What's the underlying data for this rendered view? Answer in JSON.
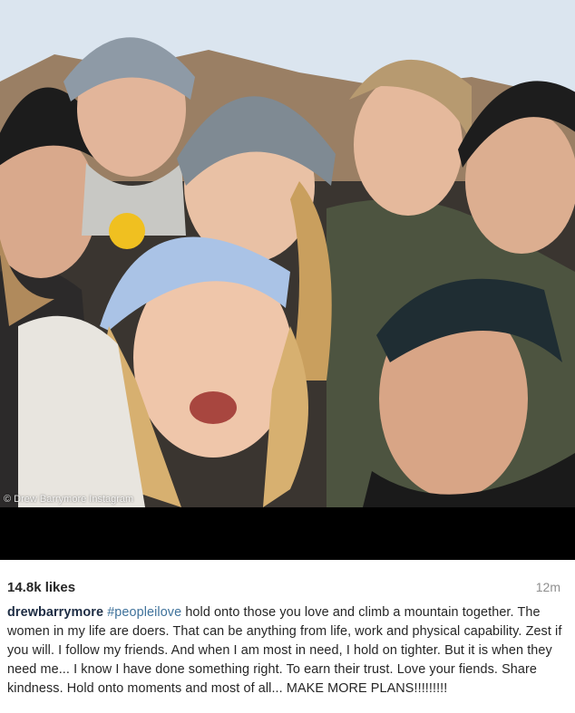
{
  "post": {
    "likes": "14.8k likes",
    "time_ago": "12m",
    "username": "drewbarrymore",
    "hashtag": "#peopleilove",
    "caption_text": "hold onto those you love and climb a mountain together. The women in my life are doers. That can be anything from life, work and physical capability. Zest if you will. I follow my friends. And when I am most in need, I hold on tighter. But it is when they need me... I know I have done something right. To earn their trust. Love your fiends. Share kindness. Hold onto moments and most of all... MAKE MORE PLANS!!!!!!!!!"
  },
  "credit": "© Drew Barrymore Instagram",
  "colors": {
    "username": "#1e2d44",
    "hashtag": "#3f729b",
    "text": "#262626",
    "muted": "#8f8f8f"
  }
}
